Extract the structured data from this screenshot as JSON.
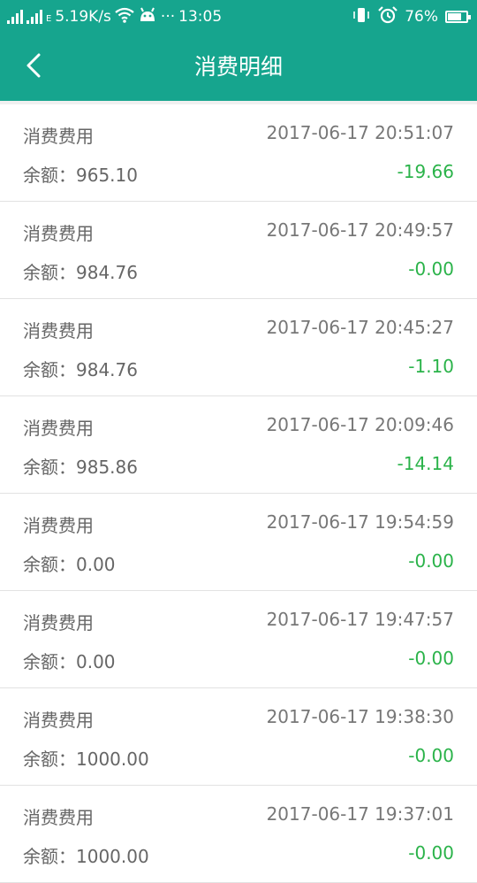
{
  "status_bar": {
    "network_type": "E",
    "speed": "5.19K/s",
    "more": "···",
    "time": "13:05",
    "battery": "76%",
    "battery_level": 0.76,
    "icons": [
      "signal-icon",
      "signal-icon",
      "wifi-icon",
      "android-icon",
      "vibrate-icon",
      "alarm-icon",
      "battery-icon"
    ]
  },
  "header": {
    "title": "消费明细",
    "back_icon": "chevron-left-icon"
  },
  "records": [
    {
      "type": "消费费用",
      "time": "2017-06-17 20:51:07",
      "balance": "余额：965.10",
      "amount": "-19.66"
    },
    {
      "type": "消费费用",
      "time": "2017-06-17 20:49:57",
      "balance": "余额：984.76",
      "amount": "-0.00"
    },
    {
      "type": "消费费用",
      "time": "2017-06-17 20:45:27",
      "balance": "余额：984.76",
      "amount": "-1.10"
    },
    {
      "type": "消费费用",
      "time": "2017-06-17 20:09:46",
      "balance": "余额：985.86",
      "amount": "-14.14"
    },
    {
      "type": "消费费用",
      "time": "2017-06-17 19:54:59",
      "balance": "余额：0.00",
      "amount": "-0.00"
    },
    {
      "type": "消费费用",
      "time": "2017-06-17 19:47:57",
      "balance": "余额：0.00",
      "amount": "-0.00"
    },
    {
      "type": "消费费用",
      "time": "2017-06-17 19:38:30",
      "balance": "余额：1000.00",
      "amount": "-0.00"
    },
    {
      "type": "消费费用",
      "time": "2017-06-17 19:37:01",
      "balance": "余额：1000.00",
      "amount": "-0.00"
    }
  ],
  "colors": {
    "primary": "#16a58e",
    "amount": "#2bb34a",
    "text": "#666666",
    "divider": "#e2e2e2"
  }
}
